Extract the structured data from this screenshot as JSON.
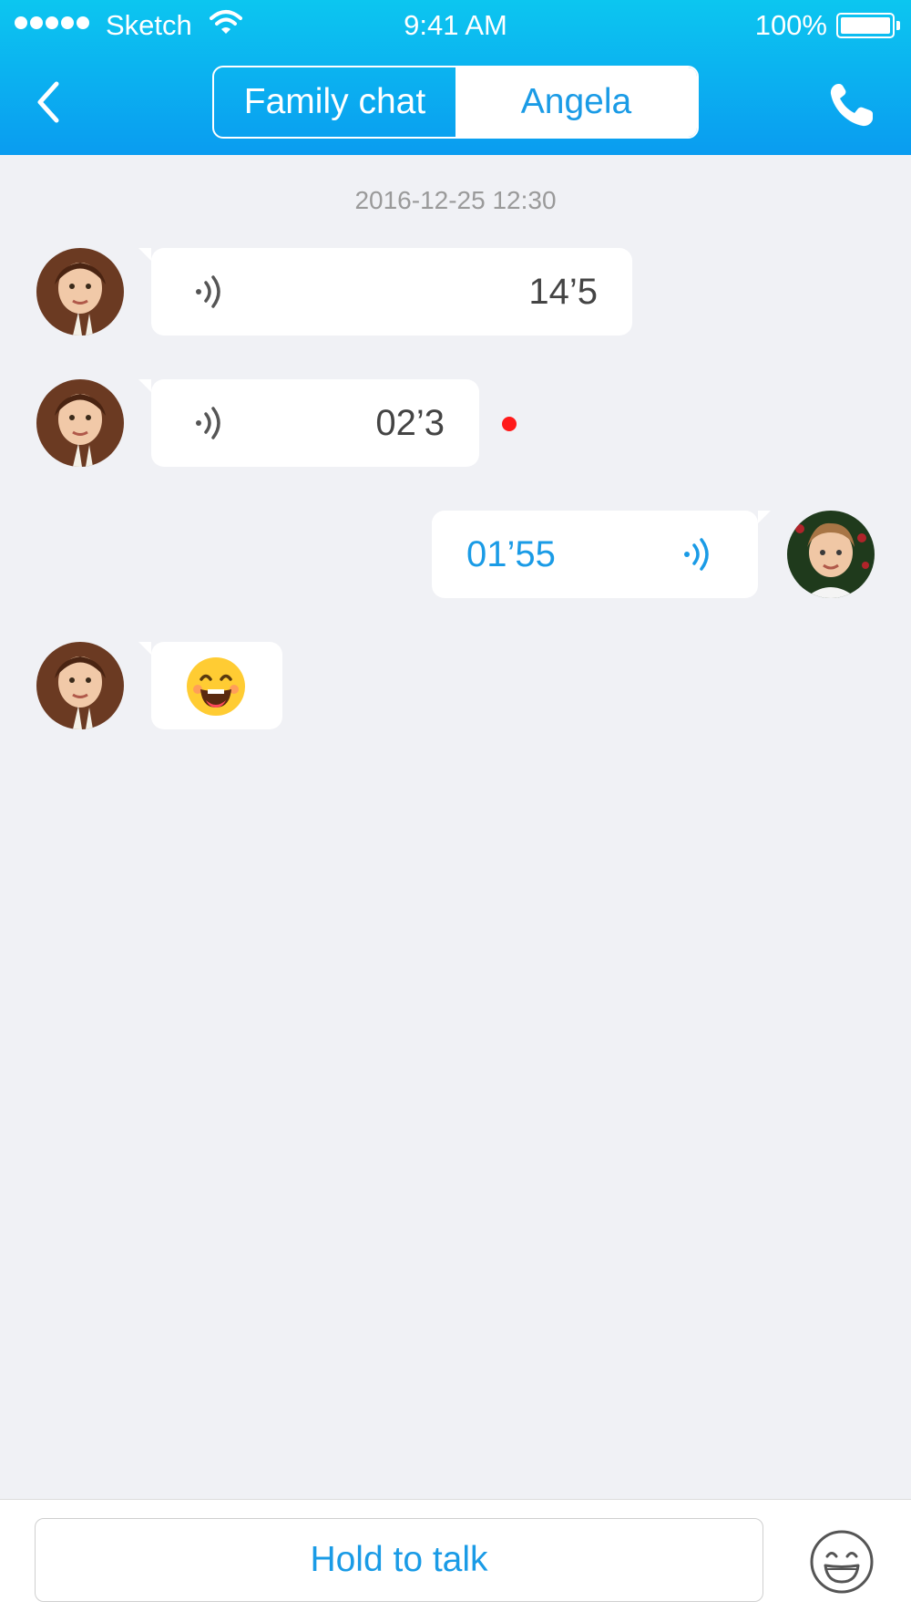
{
  "status_bar": {
    "carrier": "Sketch",
    "time": "9:41 AM",
    "battery": "100%"
  },
  "header": {
    "tabs": [
      {
        "label": "Family chat",
        "active": true
      },
      {
        "label": "Angela",
        "active": false
      }
    ]
  },
  "chat": {
    "date": "2016-12-25 12:30",
    "messages": [
      {
        "side": "left",
        "type": "voice",
        "duration": "14’5",
        "unread": false
      },
      {
        "side": "left",
        "type": "voice",
        "duration": "02’3",
        "unread": true
      },
      {
        "side": "right",
        "type": "voice",
        "duration": "01’55"
      },
      {
        "side": "left",
        "type": "emoji",
        "emoji": "grinning-face"
      }
    ]
  },
  "input_bar": {
    "hold_label": "Hold to talk"
  },
  "colors": {
    "accent": "#1a9be6",
    "header_top": "#0cc6f0",
    "header_bottom": "#0a9cf0",
    "unread_dot": "#ff1a1a",
    "background": "#f0f1f5"
  }
}
